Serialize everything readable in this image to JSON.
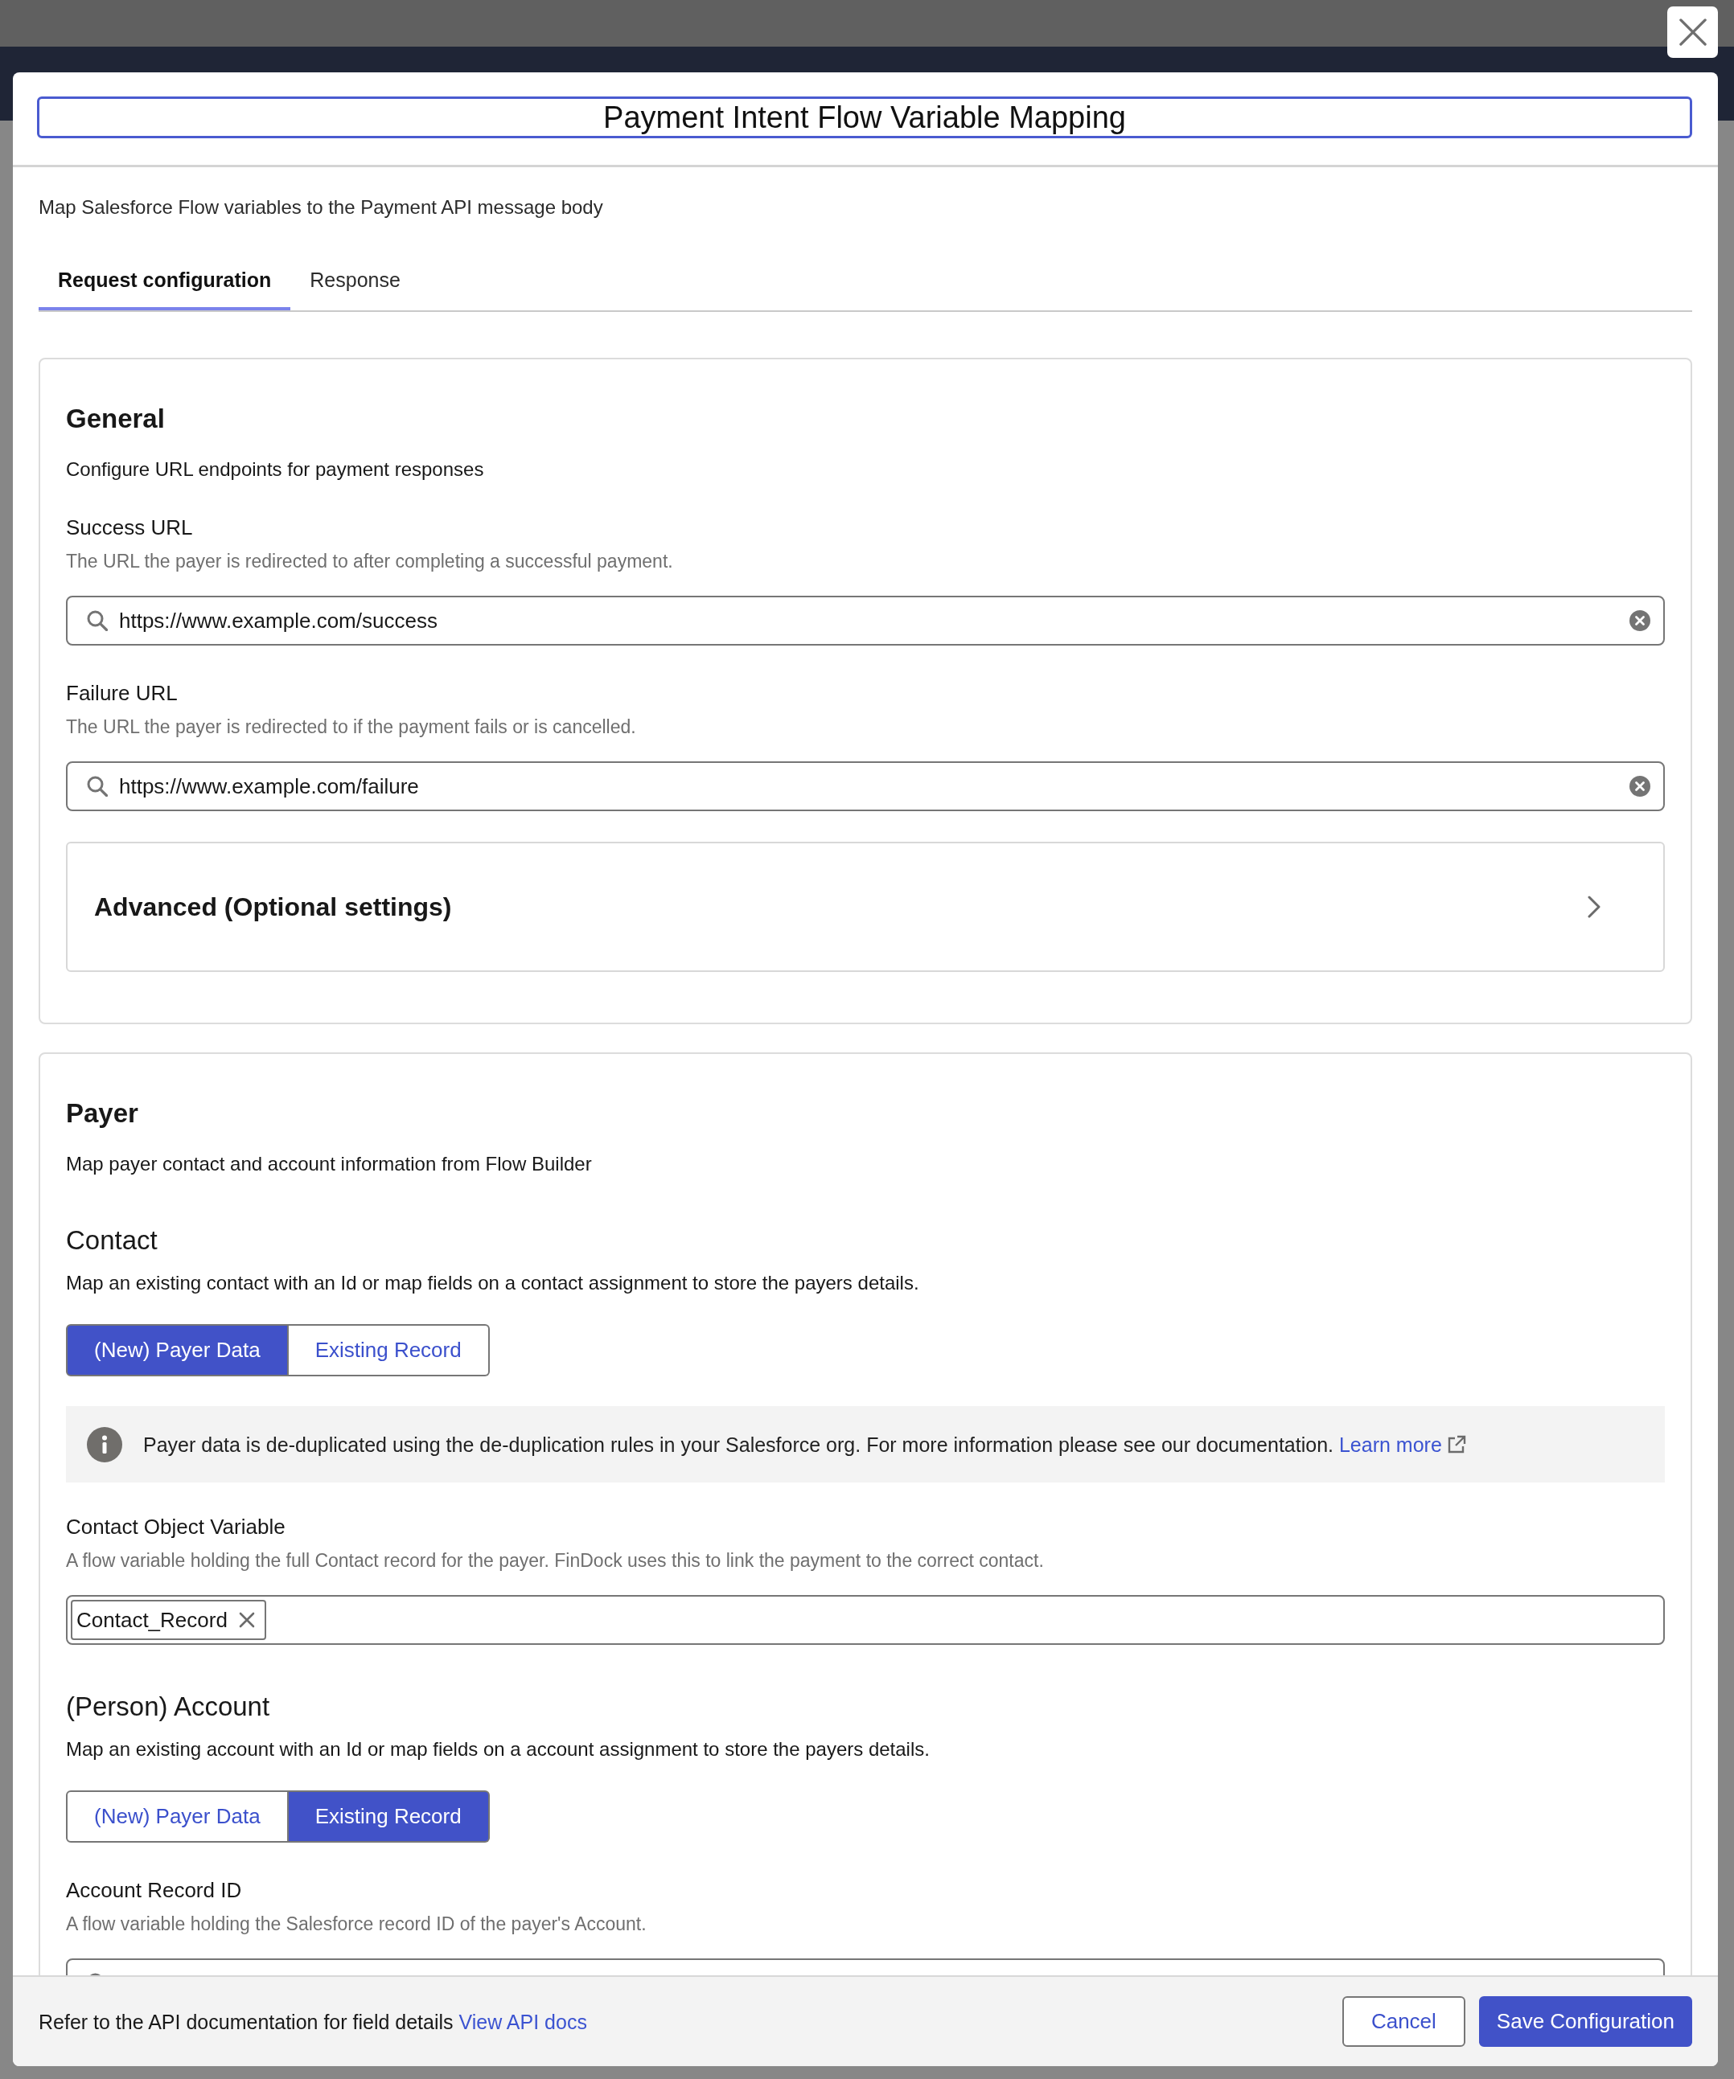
{
  "dialog": {
    "title": "Payment Intent Flow Variable Mapping",
    "description": "Map Salesforce Flow variables to the Payment API message body"
  },
  "tabs": [
    {
      "label": "Request configuration",
      "selected": true
    },
    {
      "label": "Response",
      "selected": false
    }
  ],
  "general": {
    "heading": "General",
    "description": "Configure URL endpoints for payment responses",
    "fields": [
      {
        "label": "Success URL",
        "help": "The URL the payer is redirected to after completing a successful payment.",
        "value": "https://www.example.com/success"
      },
      {
        "label": "Failure URL",
        "help": "The URL the payer is redirected to if the payment fails or is cancelled.",
        "value": "https://www.example.com/failure"
      }
    ],
    "advanced": {
      "title": "Advanced (Optional settings)",
      "expanded": false
    }
  },
  "payer": {
    "heading": "Payer",
    "description": "Map payer contact and account information from Flow Builder",
    "groups": [
      {
        "heading": "Contact",
        "description": "Map an existing contact with an Id or map fields on a contact assignment to store the payers details.",
        "options": [
          {
            "label": "(New) Payer Data",
            "selected": true
          },
          {
            "label": "Existing Record",
            "selected": false
          }
        ],
        "notice": {
          "text": "Payer data is de-duplicated using the de-duplication rules in your Salesforce org. For more information please see our documentation.",
          "link": "Learn more"
        },
        "field": {
          "kind": "pills",
          "label": "Contact Object Variable",
          "help": "A flow variable holding the full Contact record for the payer. FinDock uses this to link the payment to the correct contact.",
          "pills": [
            "Contact_Record"
          ]
        }
      },
      {
        "heading": "(Person) Account",
        "description": "Map an existing account with an Id or map fields on a account assignment to store the payers details.",
        "options": [
          {
            "label": "(New) Payer Data",
            "selected": false
          },
          {
            "label": "Existing Record",
            "selected": true
          }
        ],
        "field": {
          "kind": "search",
          "label": "Account Record ID",
          "help": "A flow variable holding the Salesforce record ID of the payer's Account."
        }
      }
    ]
  },
  "footer": {
    "text": "Refer to the API documentation for field details",
    "link": "View API docs",
    "buttons": [
      {
        "label": "Cancel",
        "kind": "neutral"
      },
      {
        "label": "Save Configuration",
        "kind": "brand"
      }
    ]
  }
}
